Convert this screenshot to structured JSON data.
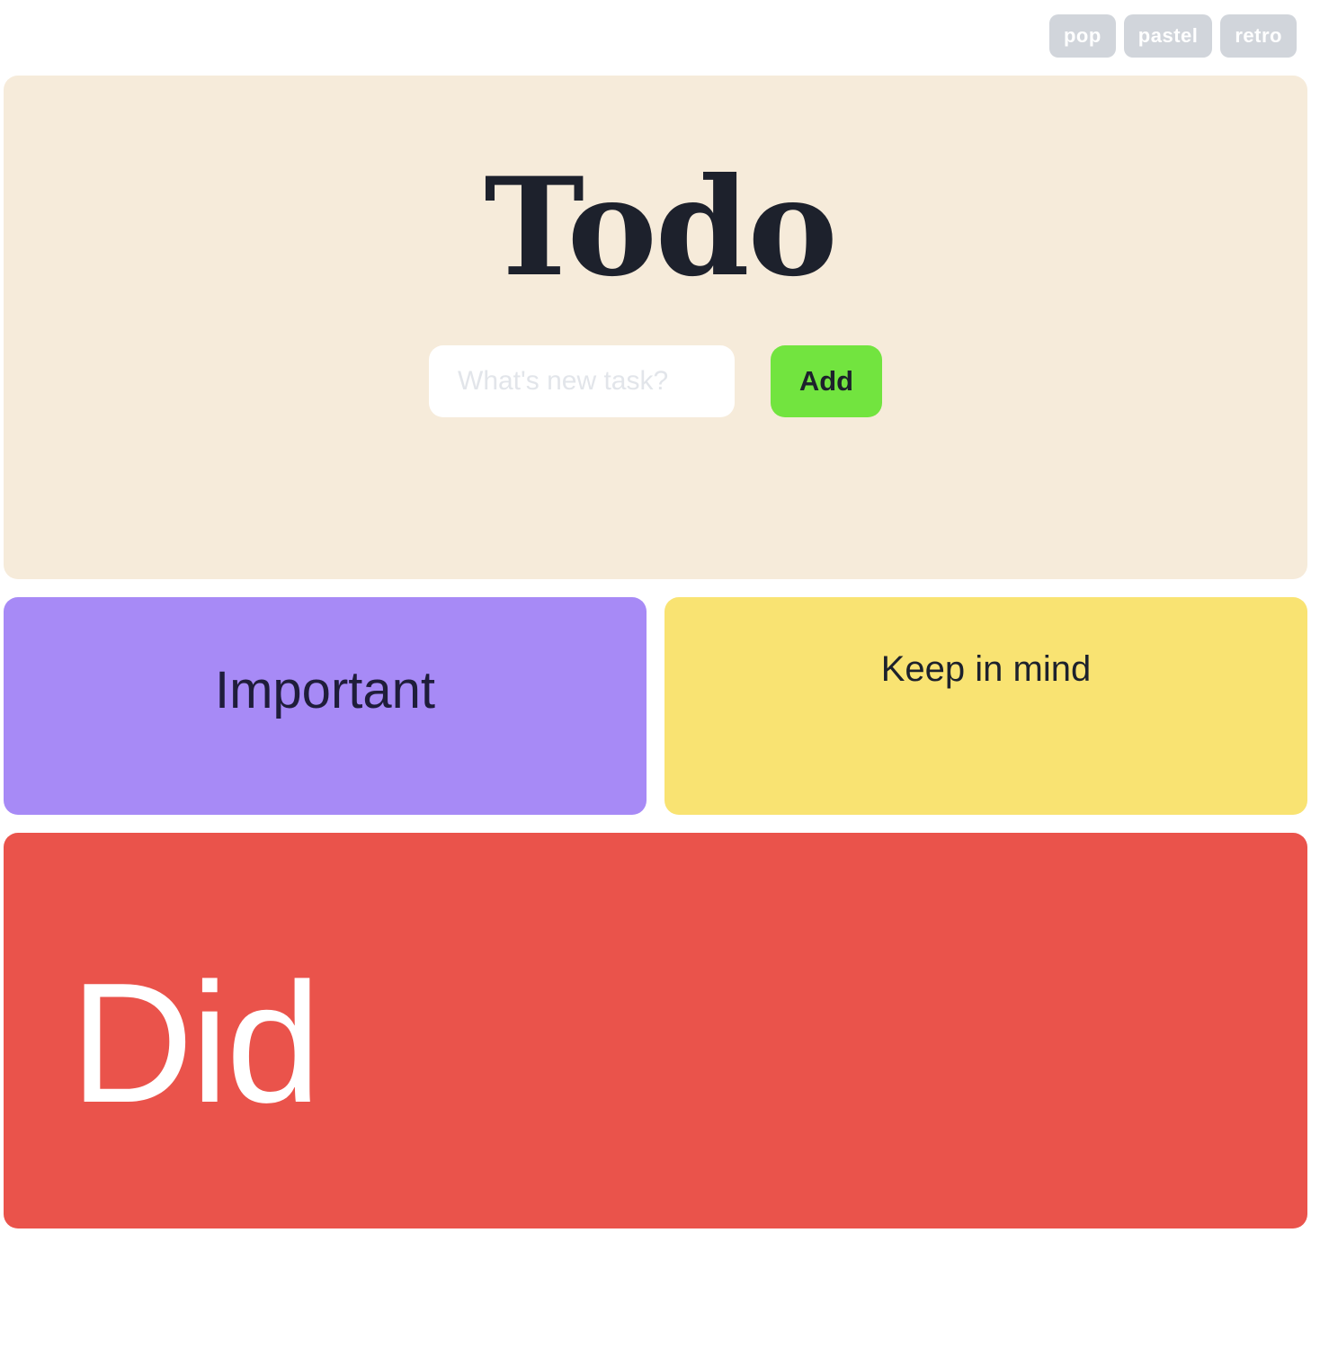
{
  "themes": {
    "items": [
      {
        "label": "pop"
      },
      {
        "label": "pastel"
      },
      {
        "label": "retro"
      }
    ]
  },
  "header": {
    "title": "Todo",
    "input_placeholder": "What's new task?",
    "input_value": "",
    "add_label": "Add"
  },
  "columns": {
    "important": {
      "label": "Important"
    },
    "keep_in_mind": {
      "label": "Keep in mind"
    },
    "did": {
      "label": "Did"
    }
  },
  "colors": {
    "header_bg": "#f6ebda",
    "important_bg": "#a78af6",
    "keep_in_mind_bg": "#f9e372",
    "did_bg": "#ea534b",
    "add_button_bg": "#72e43f",
    "theme_button_bg": "#d1d5db",
    "title_text": "#1d212c"
  }
}
